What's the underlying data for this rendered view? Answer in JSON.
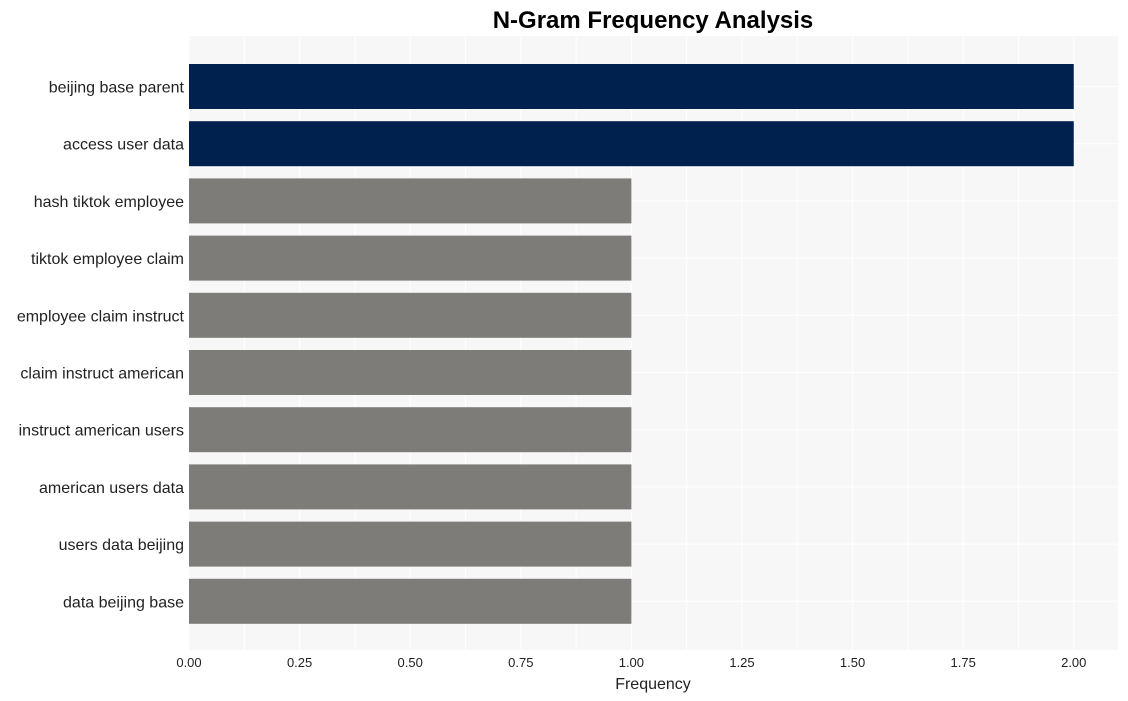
{
  "chart_data": {
    "type": "bar",
    "orientation": "horizontal",
    "title": "N-Gram Frequency Analysis",
    "xlabel": "Frequency",
    "ylabel": "",
    "xlim": [
      0,
      2.1
    ],
    "xticks": [
      "0.00",
      "0.25",
      "0.50",
      "0.75",
      "1.00",
      "1.25",
      "1.50",
      "1.75",
      "2.00"
    ],
    "grid": true,
    "categories": [
      "beijing base parent",
      "access user data",
      "hash tiktok employee",
      "tiktok employee claim",
      "employee claim instruct",
      "claim instruct american",
      "instruct american users",
      "american users data",
      "users data beijing",
      "data beijing base"
    ],
    "values": [
      2,
      2,
      1,
      1,
      1,
      1,
      1,
      1,
      1,
      1
    ],
    "colors": {
      "highlight": "#00214d",
      "default": "#7d7c78",
      "plot_background": "#f7f7f7",
      "grid": "#ffffff"
    }
  }
}
